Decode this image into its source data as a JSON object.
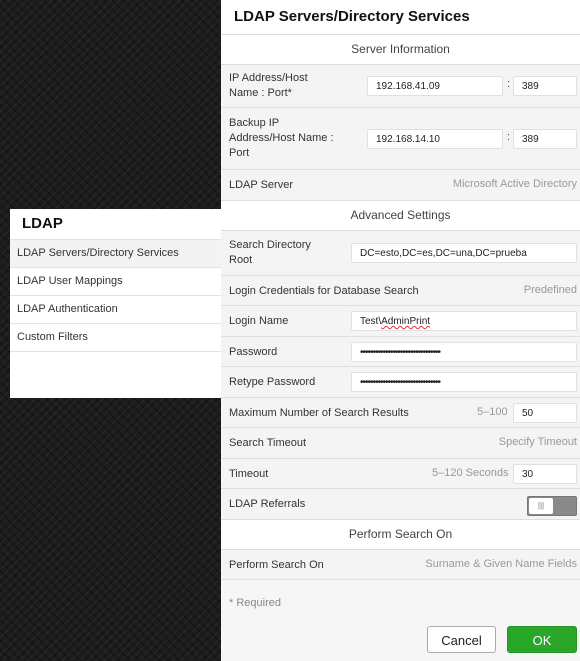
{
  "menu": {
    "title": "LDAP",
    "items": [
      {
        "label": "LDAP Servers/Directory Services"
      },
      {
        "label": "LDAP User Mappings"
      },
      {
        "label": "LDAP Authentication"
      },
      {
        "label": "Custom Filters"
      }
    ]
  },
  "dialog": {
    "title": "LDAP Servers/Directory Services",
    "sections": {
      "server_info": "Server Information",
      "advanced": "Advanced Settings",
      "perform": "Perform Search On"
    },
    "ip_label": "IP Address/Host Name : Port*",
    "ip_value": "192.168.41.09",
    "port_value": "389",
    "backup_label": "Backup IP Address/Host Name : Port",
    "backup_value": "192.168.14.10",
    "backup_port": "389",
    "colon": ":",
    "ldap_server_label": "LDAP Server",
    "ldap_server_value": "Microsoft Active Directory",
    "search_root_label": "Search Directory Root",
    "search_root_value": "DC=esto,DC=es,DC=una,DC=prueba",
    "login_cred_label": "Login Credentials for Database Search",
    "login_cred_value": "Predefined",
    "login_name_label": "Login Name",
    "login_name_prefix": "Test\\",
    "login_name_suffix": "AdminPrint",
    "password_label": "Password",
    "password_value": "••••••••••••••••••••••••••••••••",
    "retype_label": "Retype Password",
    "retype_value": "••••••••••••••••••••••••••••••••",
    "max_results_label": "Maximum Number of Search Results",
    "max_results_hint": "5–100",
    "max_results_value": "50",
    "search_timeout_label": "Search Timeout",
    "search_timeout_value": "Specify Timeout",
    "timeout_label": "Timeout",
    "timeout_hint": "5–120 Seconds",
    "timeout_value": "30",
    "referrals_label": "LDAP Referrals",
    "referrals_on": false,
    "perform_label": "Perform Search On",
    "perform_value": "Surname & Given Name Fields",
    "required_note": "* Required",
    "cancel_label": "Cancel",
    "ok_label": "OK",
    "ok_color": "#2aa62a"
  }
}
